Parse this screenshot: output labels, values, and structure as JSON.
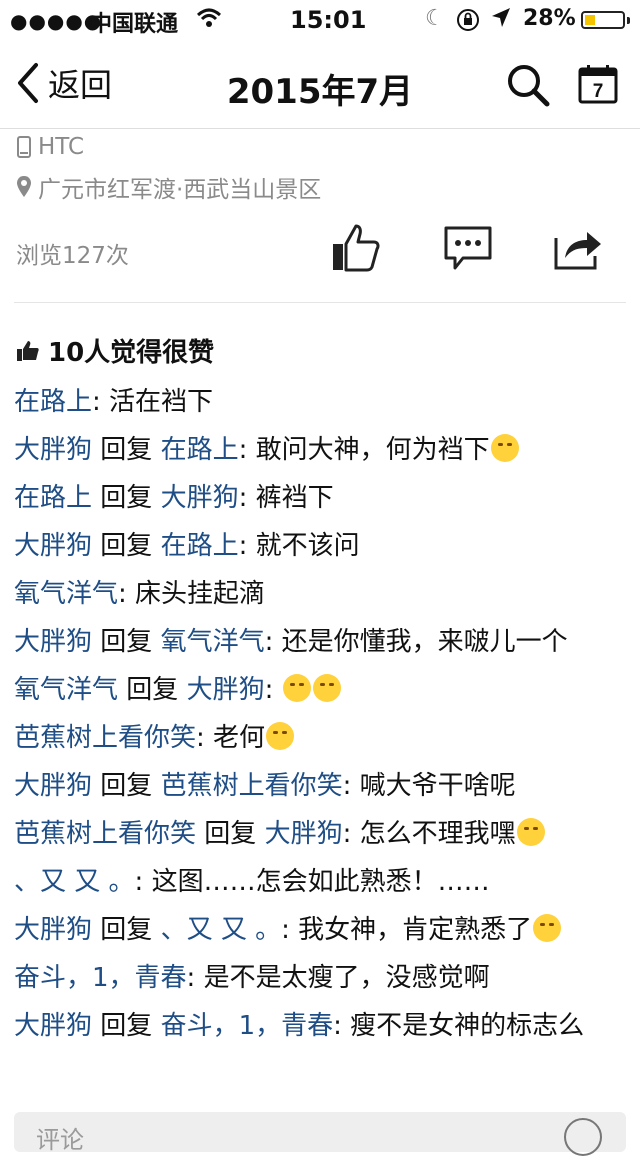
{
  "status_bar": {
    "signal": "●●●●●",
    "carrier": "中国联通",
    "time": "15:01",
    "battery_text": "28%",
    "battery_level": 0.28,
    "battery_color": "#f5c400"
  },
  "nav": {
    "back_label": "返回",
    "title": "2015年7月",
    "calendar_day": "7"
  },
  "post": {
    "device": "HTC",
    "location": "广元市红军渡·西武当山景区",
    "views": "浏览127次",
    "likes": "10人觉得很赞"
  },
  "comments": [
    {
      "author": "在路上",
      "reply_word": "",
      "reply_to": "",
      "text": "活在裆下"
    },
    {
      "author": "大胖狗",
      "reply_word": "回复",
      "reply_to": "在路上",
      "text": "敢问大神，何为裆下"
    },
    {
      "author": "在路上",
      "reply_word": "回复",
      "reply_to": "大胖狗",
      "text": "裤裆下"
    },
    {
      "author": "大胖狗",
      "reply_word": "回复",
      "reply_to": "在路上",
      "text": "就不该问"
    },
    {
      "author": "氧气洋气",
      "reply_word": "",
      "reply_to": "",
      "text": "床头挂起滴"
    },
    {
      "author": "大胖狗",
      "reply_word": "回复",
      "reply_to": "氧气洋气",
      "text": "还是你懂我，来啵儿一个"
    },
    {
      "author": "氧气洋气",
      "reply_word": "回复",
      "reply_to": "大胖狗",
      "text": ""
    },
    {
      "author": "芭蕉树上看你笑",
      "reply_word": "",
      "reply_to": "",
      "text": "老何"
    },
    {
      "author": "大胖狗",
      "reply_word": "回复",
      "reply_to": "芭蕉树上看你笑",
      "text": "喊大爷干啥呢"
    },
    {
      "author": "芭蕉树上看你笑",
      "reply_word": "回复",
      "reply_to": "大胖狗",
      "text": "怎么不理我嘿"
    },
    {
      "author": "、又 又 。",
      "reply_word": "",
      "reply_to": "",
      "text": "这图……怎会如此熟悉！……"
    },
    {
      "author": "大胖狗",
      "reply_word": "回复",
      "reply_to": "、又 又 。",
      "text": "我女神，肯定熟悉了"
    },
    {
      "author": "奋斗，1，青春",
      "reply_word": "",
      "reply_to": "",
      "text": "是不是太瘦了，没感觉啊"
    },
    {
      "author": "大胖狗",
      "reply_word": "回复",
      "reply_to": "奋斗，1，青春",
      "text": "瘦不是女神的标志么"
    }
  ],
  "composer": {
    "placeholder": "评论"
  },
  "icons": {
    "back": "chevron-left-icon",
    "search": "search-icon",
    "calendar": "calendar-icon",
    "device": "phone-icon",
    "location": "location-pin-icon",
    "like": "thumbs-up-icon",
    "comment": "comment-bubble-icon",
    "share": "share-icon",
    "emoji": "smiley-icon"
  },
  "colors": {
    "name_link": "#1f4e86",
    "meta_gray": "#8a8a8a"
  }
}
